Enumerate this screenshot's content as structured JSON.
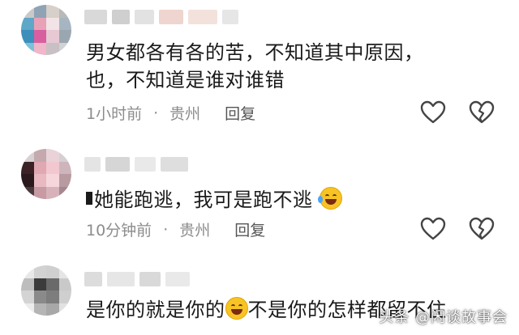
{
  "comments": [
    {
      "text_line1": "男女都各有各的苦，不知道其中原因，",
      "text_line2": "也，不知道是谁对谁错",
      "time": "1小时前",
      "separator": "·",
      "location": "贵州",
      "reply_label": "回复",
      "like_icon": "heart-outline-icon",
      "dislike_icon": "broken-heart-icon"
    },
    {
      "text_prefix": "她能跑逃，我可是跑不逃",
      "emoji": "laughing-tears-emoji",
      "time": "10分钟前",
      "separator": "·",
      "location": "贵州",
      "reply_label": "回复",
      "like_icon": "heart-outline-icon",
      "dislike_icon": "broken-heart-icon"
    },
    {
      "text_part1": "是你的就是你的",
      "emoji": "grinning-emoji",
      "text_part2": "不是你的怎样都留不住"
    }
  ],
  "watermark": "头条 @闲谈故事会",
  "colors": {
    "text": "#1a1a1a",
    "meta": "#8c8c8c",
    "icon_stroke": "#444444",
    "background": "#ffffff"
  }
}
